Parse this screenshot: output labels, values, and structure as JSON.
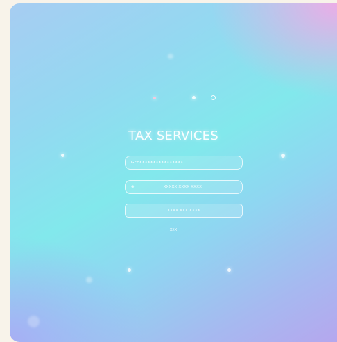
{
  "app": {
    "title": "TAX SERVICES"
  },
  "login": {
    "field1": {
      "placeholder": "GEEXXXXXXXXXXXXXXXX"
    },
    "field2": {
      "icon": "key-icon",
      "icon_glyph": "⊕",
      "placeholder": "XXXXX XXXX XXXX"
    },
    "submit_label": "XXXX XXX XXXX",
    "link_label": "XXX"
  },
  "colors": {
    "gradient_top_right": "#f0aae6",
    "gradient_center": "#82e8ec",
    "gradient_bottom_left": "#aaaaf5",
    "page_background": "#f8f3ea"
  }
}
